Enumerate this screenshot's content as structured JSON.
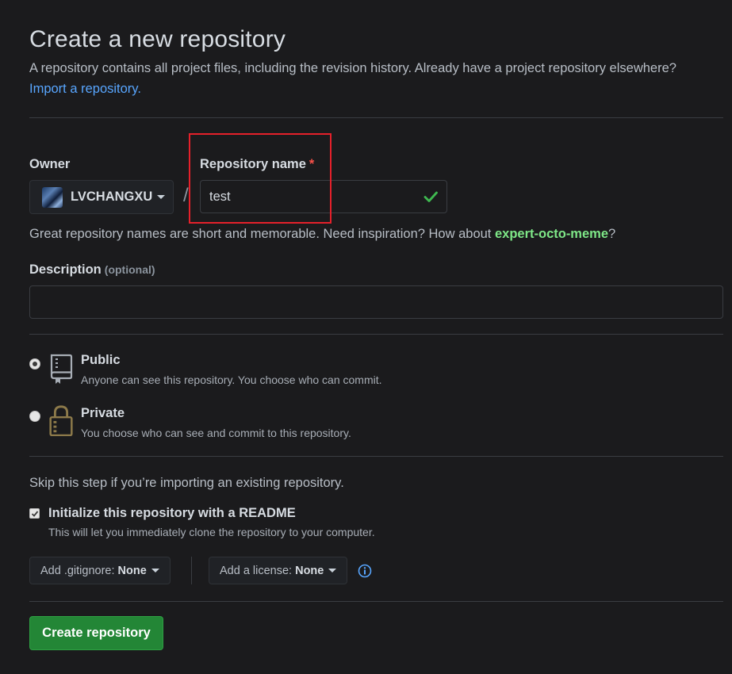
{
  "header": {
    "title": "Create a new repository",
    "subtitle": "A repository contains all project files, including the revision history. Already have a project repository elsewhere?",
    "import_link": "Import a repository."
  },
  "owner": {
    "label": "Owner",
    "value": "LVCHANGXU"
  },
  "separator": "/",
  "repo_name": {
    "label": "Repository name",
    "required_mark": "*",
    "value": "test"
  },
  "name_hint": {
    "prefix": "Great repository names are short and memorable. Need inspiration? How about ",
    "suggestion": "expert-octo-meme",
    "suffix": "?"
  },
  "description": {
    "label": "Description",
    "optional": "(optional)",
    "value": ""
  },
  "visibility": {
    "public": {
      "title": "Public",
      "desc": "Anyone can see this repository. You choose who can commit.",
      "checked": true
    },
    "private": {
      "title": "Private",
      "desc": "You choose who can see and commit to this repository.",
      "checked": false
    }
  },
  "init": {
    "skip_text": "Skip this step if you’re importing an existing repository.",
    "readme_title": "Initialize this repository with a README",
    "readme_desc": "This will let you immediately clone the repository to your computer.",
    "readme_checked": true
  },
  "gitignore": {
    "label": "Add .gitignore:",
    "value": "None"
  },
  "license": {
    "label": "Add a license:",
    "value": "None"
  },
  "submit": {
    "label": "Create repository"
  },
  "colors": {
    "accent_link": "#58a6ff",
    "success": "#7ee787",
    "button_green": "#238636",
    "required_red": "#f85149",
    "highlight_red": "#e5202a"
  },
  "icons": {
    "check": "check-icon",
    "public": "repo-book-icon",
    "private": "lock-icon",
    "info": "info-icon",
    "caret": "caret-down-icon"
  }
}
